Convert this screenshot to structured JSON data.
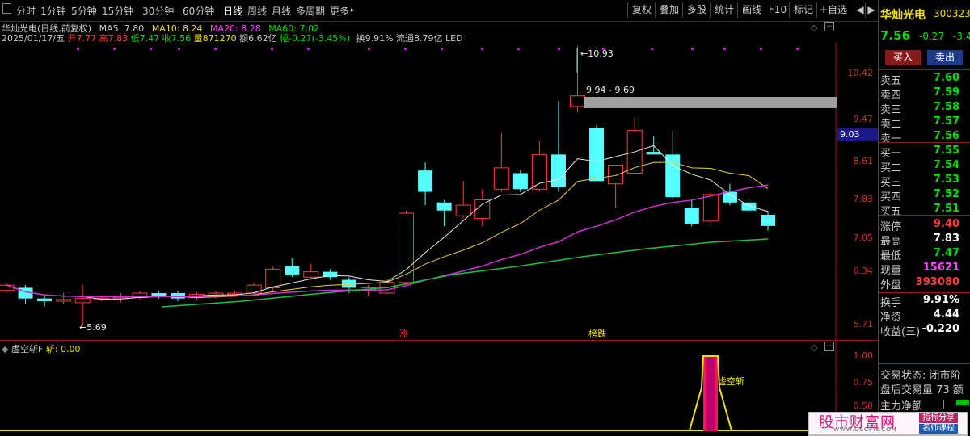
{
  "toolbar": {
    "window_icon": "square-icon",
    "periods": [
      "分时",
      "1分钟",
      "5分钟",
      "15分钟",
      "30分钟",
      "60分钟",
      "日线",
      "周线",
      "月线",
      "多周期",
      "更多"
    ],
    "active_period": "日线",
    "more_arrow": "▸",
    "right_buttons": [
      "复权",
      "叠加",
      "多股",
      "统计",
      "画线",
      "F10",
      "标记",
      "+自选"
    ],
    "nav_left": "◀",
    "nav_right": "▶"
  },
  "chart_header": {
    "title": "华灿光电(日线,前复权)",
    "ma5": "MA5: 7.80",
    "ma10": "MA10: 8.24",
    "ma20": "MA20: 8.28",
    "ma60": "MA60: 7.02",
    "date": "2025/01/17/五",
    "open": "开7.77",
    "high": "高7.83",
    "low": "低7.47",
    "close": "收7.56",
    "volume": "量871270",
    "amount": "额6.62亿",
    "change": "幅-0.27(-3.45%)",
    "turnover": "换9.91%",
    "float": "流通8.79亿",
    "sector": "LED"
  },
  "chart_data": {
    "type": "candlestick",
    "y_ticks": [
      "10.42",
      "9.47",
      "8.61",
      "7.83",
      "7.05",
      "6.34",
      "5.71"
    ],
    "high_label": "10.93",
    "low_label": "5.69",
    "range_label": "9.94 - 9.69",
    "price_box": "9.03",
    "markers": [
      "涨",
      "榜跌"
    ],
    "candles": [
      {
        "o": 6.35,
        "c": 6.45,
        "h": 6.5,
        "l": 6.3
      },
      {
        "o": 6.4,
        "c": 6.2,
        "h": 6.45,
        "l": 6.1
      },
      {
        "o": 6.2,
        "c": 6.15,
        "h": 6.25,
        "l": 6.05
      },
      {
        "o": 6.15,
        "c": 6.18,
        "h": 6.3,
        "l": 6.1
      },
      {
        "o": 6.12,
        "c": 6.2,
        "h": 6.45,
        "l": 5.69
      },
      {
        "o": 6.2,
        "c": 6.2,
        "h": 6.25,
        "l": 6.15
      },
      {
        "o": 6.2,
        "c": 6.22,
        "h": 6.3,
        "l": 6.12
      },
      {
        "o": 6.22,
        "c": 6.3,
        "h": 6.35,
        "l": 6.18
      },
      {
        "o": 6.3,
        "c": 6.25,
        "h": 6.35,
        "l": 6.2
      },
      {
        "o": 6.3,
        "c": 6.2,
        "h": 6.35,
        "l": 6.15
      },
      {
        "o": 6.22,
        "c": 6.28,
        "h": 6.32,
        "l": 6.18
      },
      {
        "o": 6.25,
        "c": 6.3,
        "h": 6.35,
        "l": 6.2
      },
      {
        "o": 6.3,
        "c": 6.3,
        "h": 6.35,
        "l": 6.25
      },
      {
        "o": 6.3,
        "c": 6.45,
        "h": 6.5,
        "l": 6.28
      },
      {
        "o": 6.4,
        "c": 6.75,
        "h": 6.8,
        "l": 6.35
      },
      {
        "o": 6.8,
        "c": 6.65,
        "h": 6.95,
        "l": 6.6
      },
      {
        "o": 6.6,
        "c": 6.7,
        "h": 6.85,
        "l": 6.55
      },
      {
        "o": 6.7,
        "c": 6.6,
        "h": 6.75,
        "l": 6.55
      },
      {
        "o": 6.55,
        "c": 6.4,
        "h": 6.6,
        "l": 6.3
      },
      {
        "o": 6.35,
        "c": 6.4,
        "h": 6.45,
        "l": 6.25
      },
      {
        "o": 6.3,
        "c": 6.5,
        "h": 6.55,
        "l": 6.28
      },
      {
        "o": 6.5,
        "c": 7.8,
        "h": 7.85,
        "l": 6.45
      },
      {
        "o": 8.6,
        "c": 8.2,
        "h": 8.75,
        "l": 7.95
      },
      {
        "o": 8.0,
        "c": 7.85,
        "h": 8.05,
        "l": 7.55
      },
      {
        "o": 7.75,
        "c": 7.95,
        "h": 8.4,
        "l": 7.7
      },
      {
        "o": 7.7,
        "c": 8.05,
        "h": 8.25,
        "l": 7.55
      },
      {
        "o": 8.25,
        "c": 8.65,
        "h": 9.3,
        "l": 8.2
      },
      {
        "o": 8.55,
        "c": 8.25,
        "h": 8.6,
        "l": 8.2
      },
      {
        "o": 8.25,
        "c": 8.9,
        "h": 9.15,
        "l": 8.2
      },
      {
        "o": 8.9,
        "c": 8.3,
        "h": 9.9,
        "l": 8.2
      },
      {
        "o": 9.8,
        "c": 10.0,
        "h": 10.93,
        "l": 9.7
      },
      {
        "o": 9.4,
        "c": 8.4,
        "h": 9.45,
        "l": 8.4
      },
      {
        "o": 8.35,
        "c": 8.7,
        "h": 8.7,
        "l": 7.9
      },
      {
        "o": 8.55,
        "c": 9.35,
        "h": 9.6,
        "l": 8.55
      },
      {
        "o": 8.95,
        "c": 8.9,
        "h": 9.25,
        "l": 8.9
      },
      {
        "o": 8.9,
        "c": 8.1,
        "h": 9.35,
        "l": 8.05
      },
      {
        "o": 7.9,
        "c": 7.6,
        "h": 8.05,
        "l": 7.55
      },
      {
        "o": 7.65,
        "c": 8.15,
        "h": 8.2,
        "l": 7.55
      },
      {
        "o": 8.2,
        "c": 8.0,
        "h": 8.35,
        "l": 7.95
      },
      {
        "o": 8.0,
        "c": 7.85,
        "h": 8.05,
        "l": 7.8
      },
      {
        "o": 7.77,
        "c": 7.56,
        "h": 7.83,
        "l": 7.47
      }
    ]
  },
  "indicator": {
    "name": "虚空斩F",
    "value": "斩: 0.00",
    "y_ticks": [
      "1.00",
      "0.75",
      "0.50"
    ],
    "signal_label": "虚空斩"
  },
  "side": {
    "stock_name": "华灿光电",
    "stock_code": "300323",
    "price": "7.56",
    "change": "-0.27",
    "change_pct": "-3.45",
    "buy_button": "买入",
    "sell_button": "卖出",
    "sell_levels": [
      {
        "label": "卖五",
        "price": "7.60"
      },
      {
        "label": "卖四",
        "price": "7.59"
      },
      {
        "label": "卖三",
        "price": "7.58"
      },
      {
        "label": "卖二",
        "price": "7.57"
      },
      {
        "label": "卖一",
        "price": "7.56"
      }
    ],
    "buy_levels": [
      {
        "label": "买一",
        "price": "7.55"
      },
      {
        "label": "买二",
        "price": "7.54"
      },
      {
        "label": "买三",
        "price": "7.53"
      },
      {
        "label": "买四",
        "price": "7.52"
      },
      {
        "label": "买五",
        "price": "7.51"
      }
    ],
    "stats": [
      {
        "label": "涨停",
        "value": "9.40",
        "color": "red"
      },
      {
        "label": "最高",
        "value": "7.83",
        "color": "white"
      },
      {
        "label": "最低",
        "value": "7.47",
        "color": "green"
      },
      {
        "label": "现量",
        "value": "15621",
        "color": "purple"
      },
      {
        "label": "外盘",
        "value": "393080",
        "color": "red"
      }
    ],
    "stats2": [
      {
        "label": "换手",
        "value": "9.91%",
        "color": "white"
      },
      {
        "label": "净资",
        "value": "4.44",
        "color": "white"
      },
      {
        "label": "收益(三)",
        "value": "-0.220",
        "color": "white"
      }
    ],
    "trade_status": "交易状态: 闭市阶",
    "after_hours": "盘后交易量 73 额",
    "main_flow": "主力净额"
  },
  "watermark": {
    "site_name": "股市财富网",
    "url": "WWW.GSCFW.COM",
    "tag1": "指标分享",
    "tag2": "名师课程"
  }
}
